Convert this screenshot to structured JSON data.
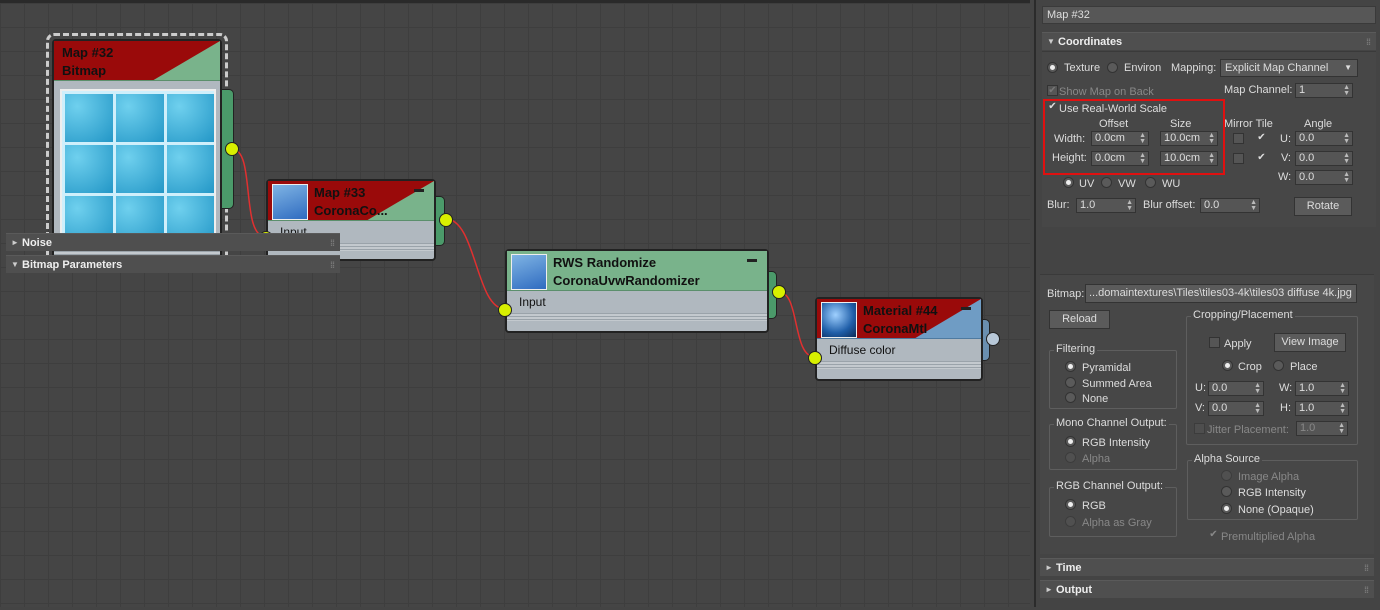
{
  "nodes": {
    "map32": {
      "title": "Map #32",
      "subtitle": "Bitmap"
    },
    "map33": {
      "title": "Map #33",
      "subtitle": "CoronaCo...",
      "input": "Input"
    },
    "rws": {
      "title": "RWS Randomize",
      "subtitle": "CoronaUvwRandomizer",
      "input": "Input"
    },
    "mat44": {
      "title": "Material #44",
      "subtitle": "CoronaMtl",
      "input": "Diffuse color"
    }
  },
  "panel": {
    "title": "Map #32",
    "coordinates": {
      "header": "Coordinates",
      "texture": "Texture",
      "environ": "Environ",
      "mapping_label": "Mapping:",
      "mapping_value": "Explicit Map Channel",
      "show_map_on_back": "Show Map on Back",
      "map_channel_label": "Map Channel:",
      "map_channel_value": "1",
      "use_real_world_scale": "Use Real-World Scale",
      "offset": "Offset",
      "size": "Size",
      "mirror_tile": "Mirror Tile",
      "angle": "Angle",
      "width": "Width:",
      "height": "Height:",
      "width_offset": "0.0cm",
      "width_size": "10.0cm",
      "height_offset": "0.0cm",
      "height_size": "10.0cm",
      "u_label": "U:",
      "v_label": "V:",
      "w_label": "W:",
      "u_angle": "0.0",
      "v_angle": "0.0",
      "w_angle": "0.0",
      "uv": "UV",
      "vw": "VW",
      "wu": "WU",
      "blur_label": "Blur:",
      "blur_value": "1.0",
      "blur_offset_label": "Blur offset:",
      "blur_offset_value": "0.0",
      "rotate": "Rotate"
    },
    "noise": {
      "header": "Noise"
    },
    "bitmap_params": {
      "header": "Bitmap Parameters",
      "bitmap_label": "Bitmap:",
      "bitmap_path": "...domaintextures\\Tiles\\tiles03-4k\\tiles03 diffuse 4k.jpg",
      "reload": "Reload",
      "cropping": "Cropping/Placement",
      "apply": "Apply",
      "view_image": "View Image",
      "crop": "Crop",
      "place": "Place",
      "cu_label": "U:",
      "cu": "0.0",
      "cw_label": "W:",
      "cw": "1.0",
      "cv_label": "V:",
      "cv": "0.0",
      "ch_label": "H:",
      "ch": "1.0",
      "jitter": "Jitter Placement:",
      "jitter_value": "1.0",
      "filtering": "Filtering",
      "pyramidal": "Pyramidal",
      "summed_area": "Summed Area",
      "none": "None",
      "mono": "Mono Channel Output:",
      "rgb_intensity": "RGB Intensity",
      "alpha": "Alpha",
      "rgb_out": "RGB Channel Output:",
      "rgb": "RGB",
      "alpha_as_gray": "Alpha as Gray",
      "alpha_source": "Alpha Source",
      "image_alpha": "Image Alpha",
      "as_rgb_intensity": "RGB Intensity",
      "none_opaque": "None (Opaque)",
      "premultiplied": "Premultiplied Alpha"
    },
    "time": {
      "header": "Time"
    },
    "output": {
      "header": "Output"
    }
  }
}
